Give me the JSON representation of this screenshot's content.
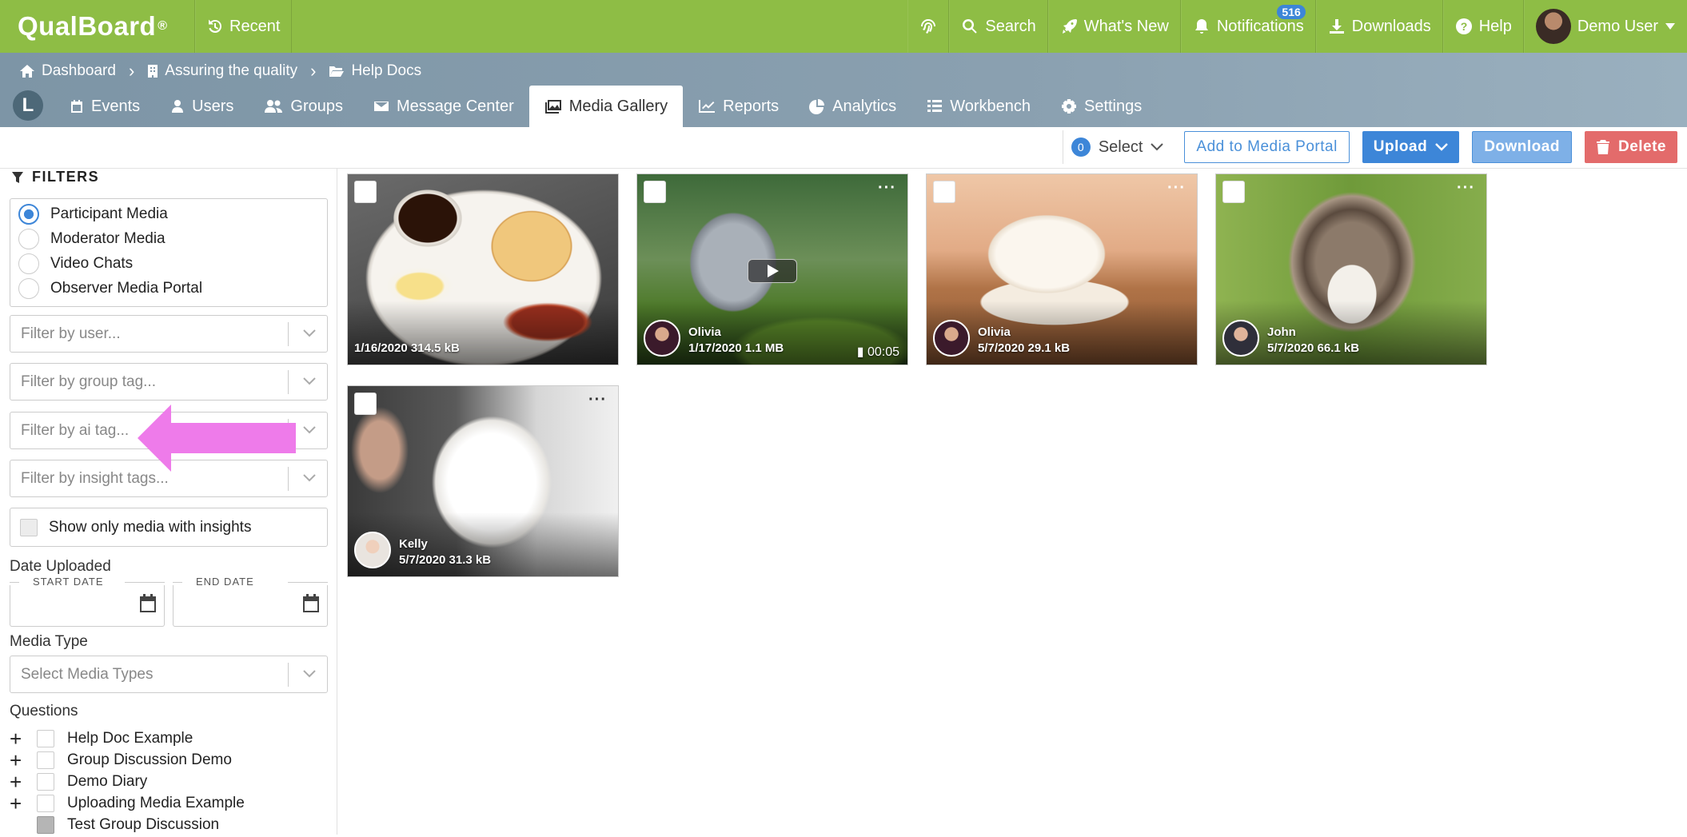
{
  "topbar": {
    "logo": "QualBoard",
    "logo_mark": "®",
    "recent": "Recent",
    "search": "Search",
    "whats_new": "What's New",
    "notifications": "Notifications",
    "notifications_count": "516",
    "downloads": "Downloads",
    "help": "Help",
    "user": "Demo User"
  },
  "breadcrumb": [
    "Dashboard",
    "Assuring the quality",
    "Help Docs"
  ],
  "nav": {
    "home_glyph": "L",
    "tabs": [
      "Events",
      "Users",
      "Groups",
      "Message Center",
      "Media Gallery",
      "Reports",
      "Analytics",
      "Workbench",
      "Settings"
    ],
    "active": "Media Gallery"
  },
  "actions": {
    "select_count": "0",
    "select": "Select",
    "add_portal": "Add to Media Portal",
    "upload": "Upload",
    "download": "Download",
    "delete": "Delete"
  },
  "filters": {
    "title": "FILTERS",
    "radios": [
      "Participant Media",
      "Moderator Media",
      "Video Chats",
      "Observer Media Portal"
    ],
    "selected_radio": "Participant Media",
    "user_placeholder": "Filter by user...",
    "group_tag_placeholder": "Filter by group tag...",
    "ai_tag_placeholder": "Filter by ai tag...",
    "insight_tags_placeholder": "Filter by insight tags...",
    "insights_only": "Show only media with insights",
    "date_uploaded": "Date Uploaded",
    "start_date": "START DATE",
    "end_date": "END DATE",
    "media_type": "Media Type",
    "media_type_placeholder": "Select Media Types",
    "questions_label": "Questions",
    "questions": [
      "Help Doc Example",
      "Group Discussion Demo",
      "Demo Diary",
      "Uploading Media Example",
      "Test Group Discussion"
    ]
  },
  "media": [
    {
      "user": "",
      "info": "1/16/2020 314.5 kB",
      "duration": ""
    },
    {
      "user": "Olivia",
      "info": "1/17/2020 1.1 MB",
      "duration": "00:05"
    },
    {
      "user": "Olivia",
      "info": "5/7/2020 29.1 kB",
      "duration": ""
    },
    {
      "user": "John",
      "info": "5/7/2020 66.1 kB",
      "duration": ""
    },
    {
      "user": "Kelly",
      "info": "5/7/2020 31.3 kB",
      "duration": ""
    }
  ],
  "colors": {
    "brand_green": "#8ebd45",
    "accent_blue": "#3d86d8",
    "danger_red": "#e36b6b",
    "annotation_arrow": "#ee7bea"
  }
}
